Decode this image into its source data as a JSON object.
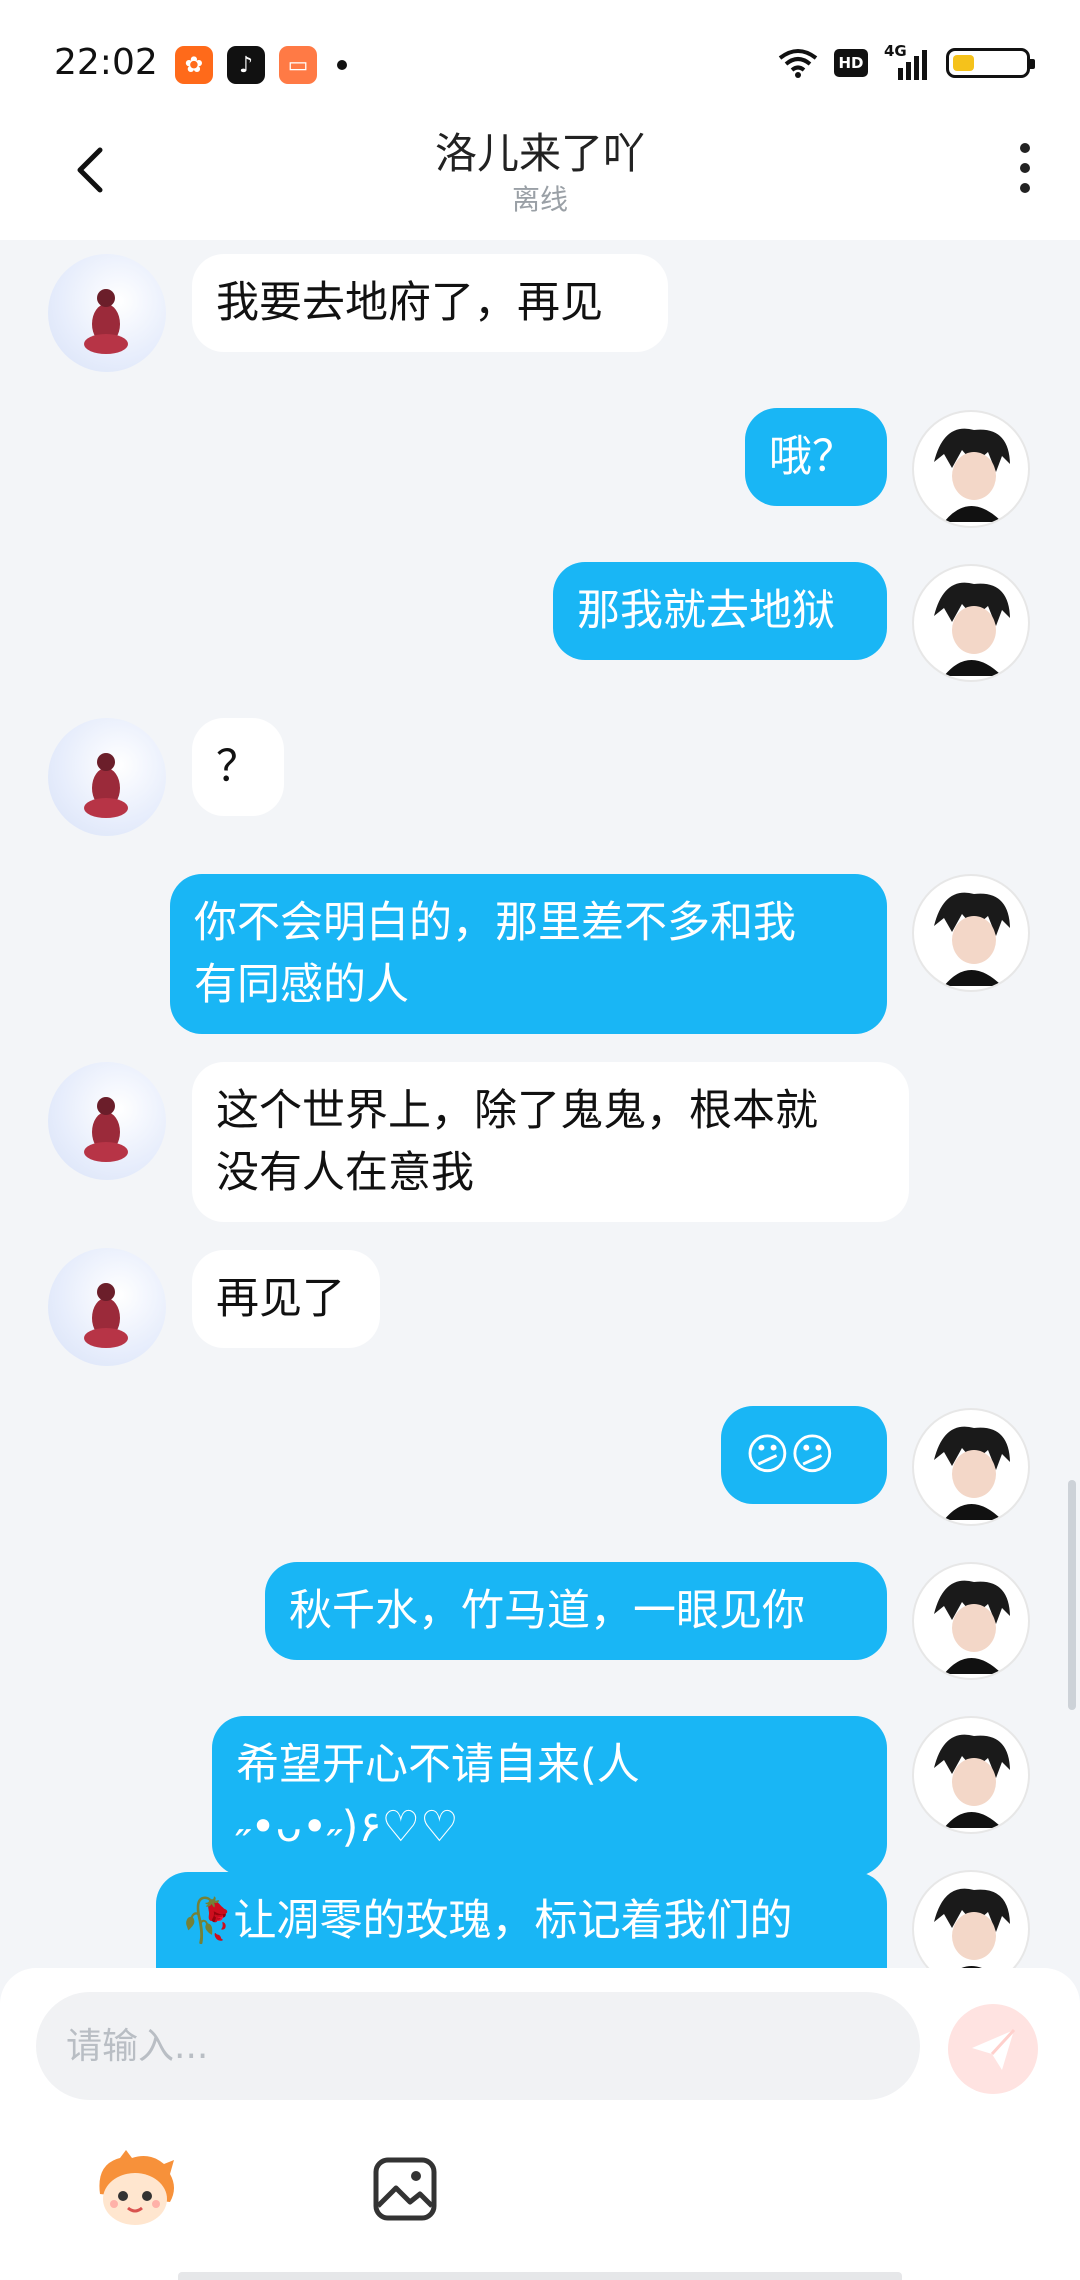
{
  "status_bar": {
    "time": "22:02",
    "network": "4G",
    "hd": "HD",
    "battery_level": 0.3,
    "apps": [
      "kuaishou-app-icon",
      "douyin-app-icon",
      "reader-app-icon"
    ]
  },
  "header": {
    "title": "洛儿来了吖",
    "status": "离线"
  },
  "messages": [
    {
      "side": "in",
      "text": "我要去地府了，再见"
    },
    {
      "side": "out",
      "text": "哦？"
    },
    {
      "side": "out",
      "text": "那我就去地狱"
    },
    {
      "side": "in",
      "text": "？"
    },
    {
      "side": "out",
      "line1": "你不会明白的，那里差不多和我",
      "line2": "有同感的人"
    },
    {
      "side": "in",
      "line1": "这个世界上，除了鬼鬼，根本就",
      "line2": "没有人在意我"
    },
    {
      "side": "in",
      "text": "再见了"
    },
    {
      "side": "out",
      "text": "😕😕"
    },
    {
      "side": "out",
      "text": "秋千水，竹马道，一眼见你"
    },
    {
      "side": "out",
      "text": "希望开心不请自来(人 ˶•ᴗ•˶)۶♡♡"
    },
    {
      "side": "out",
      "text": "🥀让凋零的玫瑰，标记着我们的"
    }
  ],
  "input": {
    "placeholder": "请输入..."
  },
  "colors": {
    "outgoing_bubble": "#19b6f5",
    "incoming_bubble": "#ffffff",
    "background": "#f3f5f8",
    "send_button": "#ffe3e1"
  },
  "icons": {
    "back": "back-arrow-icon",
    "more": "more-vertical-icon",
    "send": "send-icon",
    "sticker": "sticker-icon",
    "image": "image-icon"
  }
}
